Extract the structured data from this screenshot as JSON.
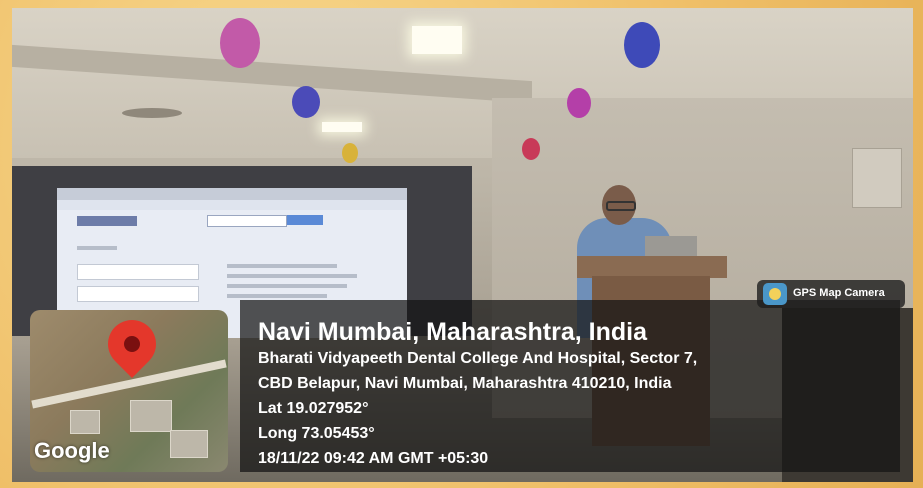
{
  "location": {
    "title": "Navi Mumbai, Maharashtra, India",
    "address_line1": "Bharati Vidyapeeth Dental College And Hospital, Sector 7,",
    "address_line2": "CBD Belapur, Navi Mumbai, Maharashtra 410210, India",
    "lat": "Lat 19.027952°",
    "long": "Long 73.05453°",
    "datetime": "18/11/22 09:42 AM GMT +05:30"
  },
  "badge": {
    "label": "GPS Map Camera"
  },
  "map": {
    "brand": "Google"
  },
  "colors": {
    "pin": "#e4372b",
    "overlay": "#141414",
    "frame": "#f3c874"
  }
}
